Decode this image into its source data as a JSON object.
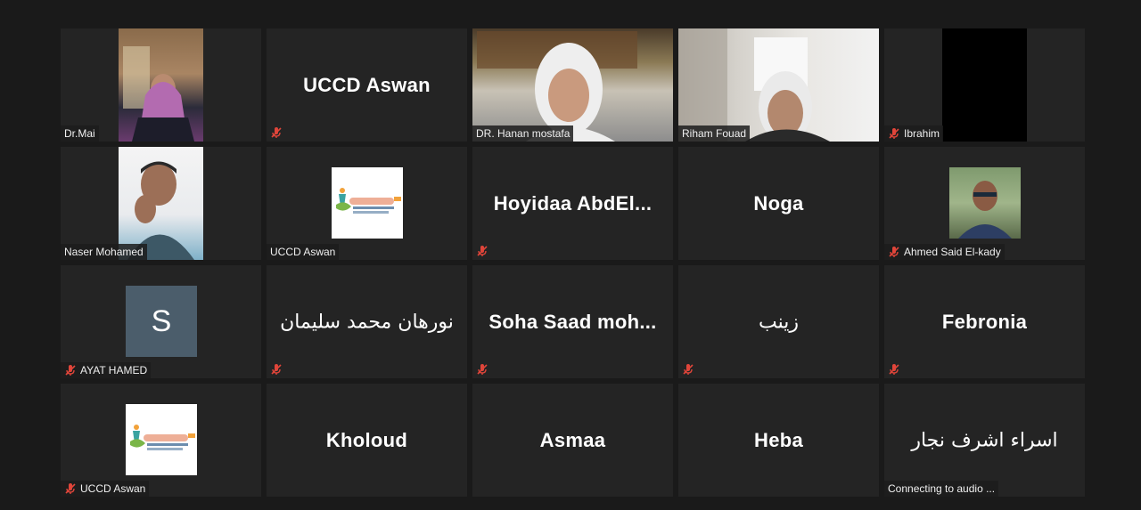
{
  "participants": [
    {
      "name": "Dr.Mai",
      "muted": false,
      "kind": "video"
    },
    {
      "name": "UCCD Aswan",
      "muted": true,
      "kind": "name"
    },
    {
      "name": "DR. Hanan mostafa",
      "muted": false,
      "kind": "video",
      "active": true
    },
    {
      "name": "Riham Fouad",
      "muted": false,
      "kind": "video"
    },
    {
      "name": "Ibrahim",
      "muted": true,
      "kind": "video-black"
    },
    {
      "name": "Naser Mohamed",
      "muted": false,
      "kind": "video"
    },
    {
      "name": "UCCD Aswan",
      "muted": false,
      "kind": "logo"
    },
    {
      "name": "Hoyidaa  AbdEl...",
      "muted": true,
      "kind": "name"
    },
    {
      "name": "Noga",
      "muted": false,
      "kind": "name"
    },
    {
      "name": "Ahmed Said El-kady",
      "muted": true,
      "kind": "photo"
    },
    {
      "name": "AYAT  HAMED",
      "muted": true,
      "kind": "avatar",
      "initial": "S"
    },
    {
      "name": "نورهان محمد سليمان",
      "muted": true,
      "kind": "name"
    },
    {
      "name": "Soha Saad  moh...",
      "muted": true,
      "kind": "name"
    },
    {
      "name": "زينب",
      "muted": true,
      "kind": "name"
    },
    {
      "name": "Febronia",
      "muted": true,
      "kind": "name"
    },
    {
      "name": "UCCD Aswan",
      "muted": true,
      "kind": "logo"
    },
    {
      "name": "Kholoud",
      "muted": false,
      "kind": "name"
    },
    {
      "name": "Asmaa",
      "muted": false,
      "kind": "name"
    },
    {
      "name": "Heba",
      "muted": false,
      "kind": "name"
    },
    {
      "name": "اسراء اشرف نجار",
      "muted": false,
      "kind": "name"
    }
  ],
  "status_labels": {
    "connecting_audio": "Connecting to audio ..."
  },
  "colors": {
    "active_border": "#c6ea5c",
    "mute_icon": "#e0453a",
    "tile_bg": "#242424",
    "page_bg": "#1a1a1a"
  }
}
